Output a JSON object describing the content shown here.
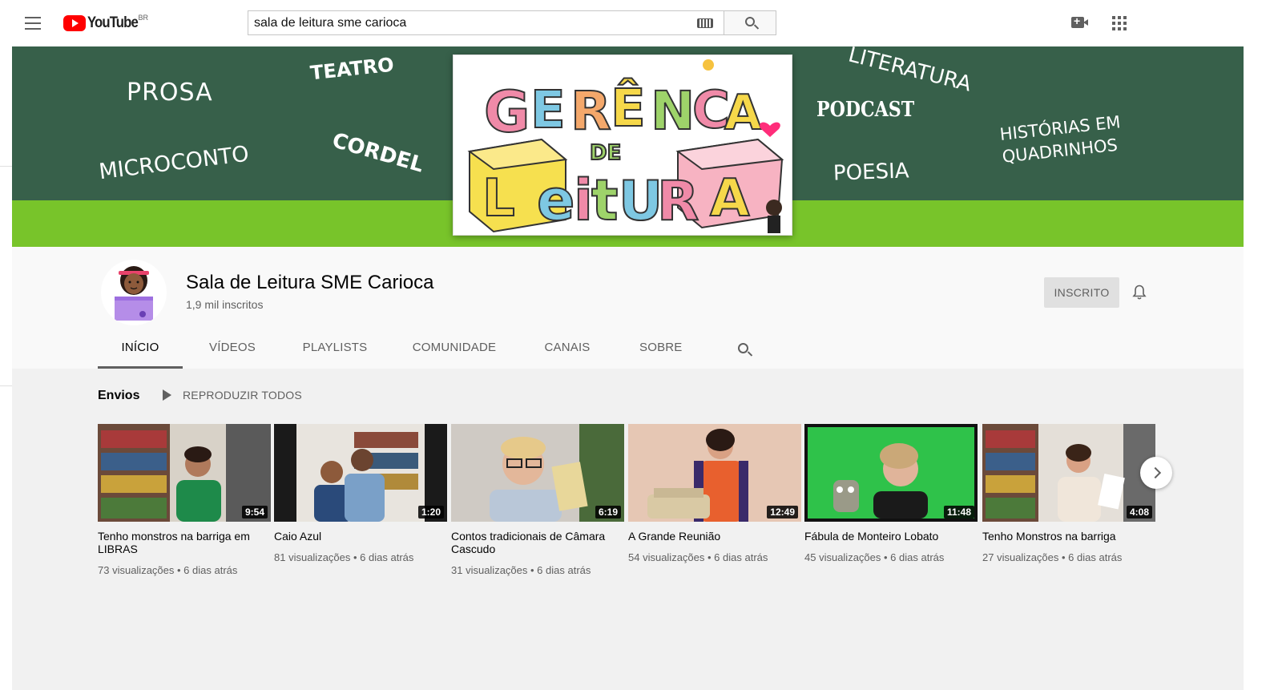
{
  "masthead": {
    "logo_text": "YouTube",
    "country_code": "BR",
    "search_value": "sala de leitura sme carioca",
    "icons": [
      "menu-icon",
      "keyboard-icon",
      "search-icon",
      "create-video-icon",
      "apps-icon"
    ]
  },
  "banner": {
    "words": {
      "prosa": "PROSA",
      "teatro": "TEATRO",
      "microconto": "MICROCONTO",
      "cordel": "CORDEL",
      "literatura": "LITERATURA",
      "podcast": "PODCAST",
      "poesia": "POESIA",
      "hq_line1": "HISTÓRIAS EM",
      "hq_line2": "QUADRINHOS"
    },
    "colors": {
      "green_dark": "#37604a",
      "green_light": "#78c42a"
    }
  },
  "channel": {
    "name": "Sala de Leitura SME Carioca",
    "subscribers": "1,9 mil inscritos",
    "subscribe_label": "INSCRITO",
    "tabs": [
      "INÍCIO",
      "VÍDEOS",
      "PLAYLISTS",
      "COMUNIDADE",
      "CANAIS",
      "SOBRE"
    ],
    "active_tab": "INÍCIO"
  },
  "uploads": {
    "title": "Envios",
    "play_all": "REPRODUZIR TODOS",
    "videos": [
      {
        "title": "Tenho monstros na barriga em LIBRAS",
        "duration": "9:54",
        "views": "73 visualizações",
        "age": "6 dias atrás"
      },
      {
        "title": "Caio Azul",
        "duration": "1:20",
        "views": "81 visualizações",
        "age": "6 dias atrás"
      },
      {
        "title": "Contos tradicionais de Câmara Cascudo",
        "duration": "6:19",
        "views": "31 visualizações",
        "age": "6 dias atrás"
      },
      {
        "title": "A Grande Reunião",
        "duration": "12:49",
        "views": "54 visualizações",
        "age": "6 dias atrás"
      },
      {
        "title": "Fábula de Monteiro Lobato",
        "duration": "11:48",
        "views": "45 visualizações",
        "age": "6 dias atrás"
      },
      {
        "title": "Tenho Monstros na barriga",
        "duration": "4:08",
        "views": "27 visualizações",
        "age": "6 dias atrás"
      }
    ]
  }
}
